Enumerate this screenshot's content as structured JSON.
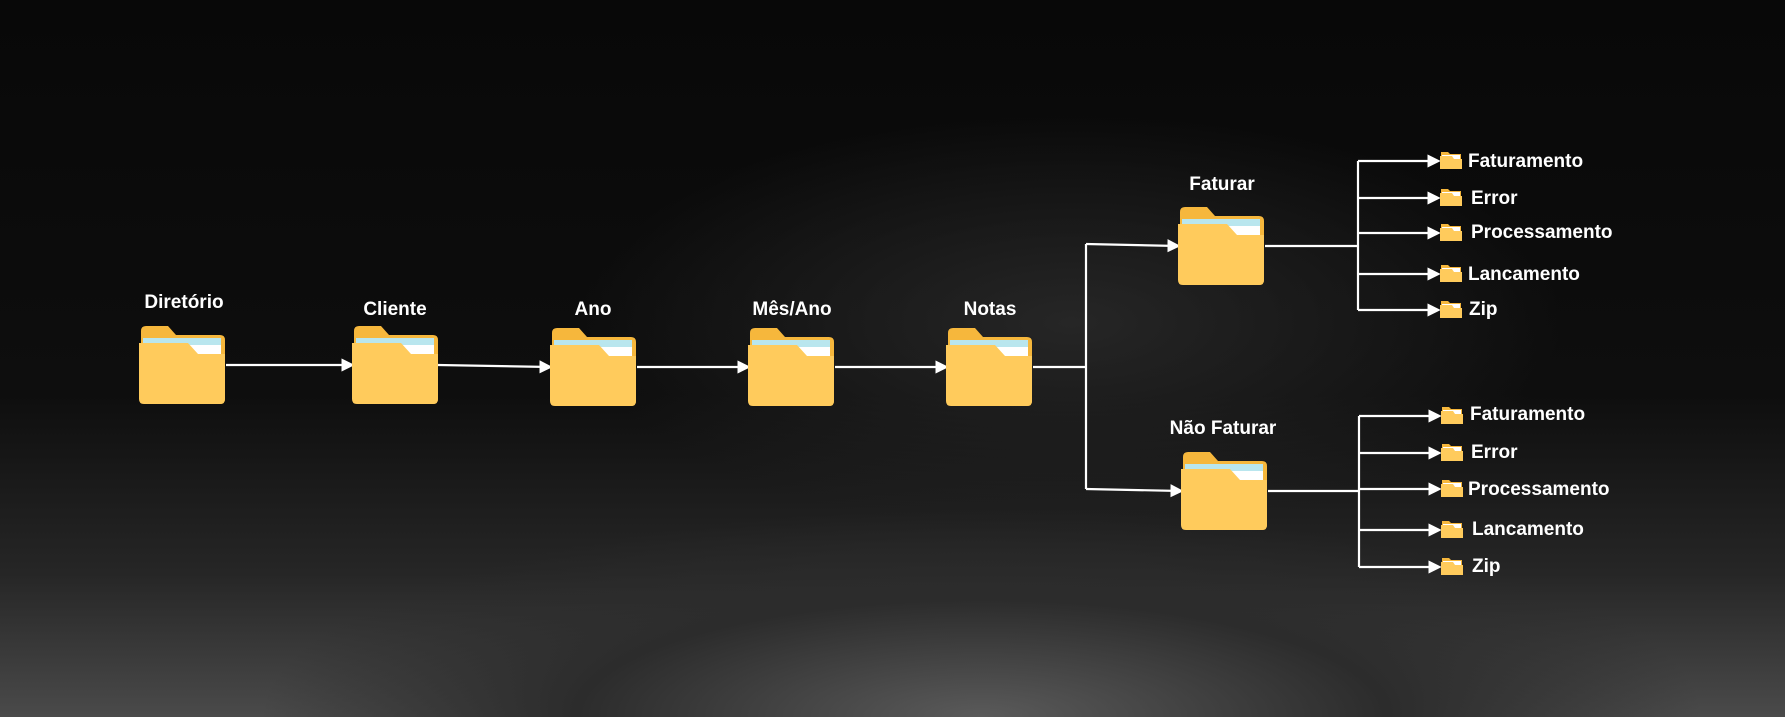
{
  "diagram": {
    "nodes": {
      "diretorio": "Diretório",
      "cliente": "Cliente",
      "ano": "Ano",
      "mes_ano": "Mês/Ano",
      "notas": "Notas",
      "faturar": "Faturar",
      "nao_faturar": "Não Faturar"
    },
    "faturar_children": [
      "Faturamento",
      "Error",
      "Processamento",
      "Lancamento",
      "Zip"
    ],
    "nao_faturar_children": [
      "Faturamento",
      "Error",
      "Processamento",
      "Lancamento",
      "Zip"
    ],
    "colors": {
      "folder_back": "#f6b73c",
      "folder_front": "#ffcb5c",
      "paper": "#ffffff",
      "paper_accent": "#b9e6ee",
      "arrow": "#ffffff"
    }
  }
}
